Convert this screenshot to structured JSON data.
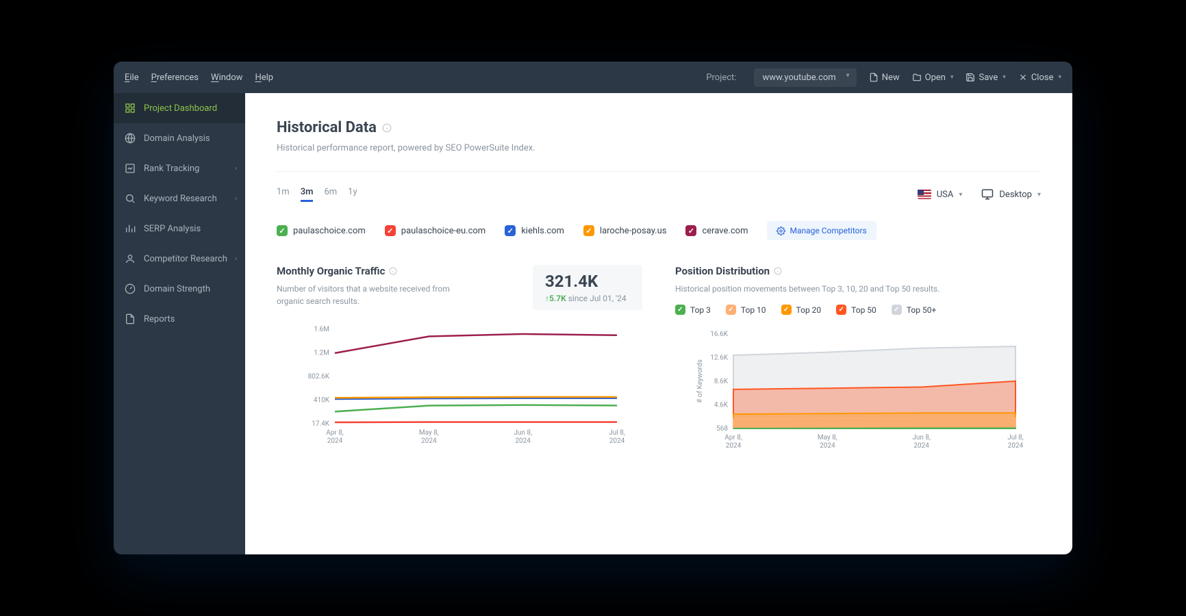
{
  "menubar": {
    "file": "File",
    "file_u": "E",
    "preferences": "Preferences",
    "preferences_u": "P",
    "window": "Window",
    "window_u": "W",
    "help": "Help",
    "help_u": "H",
    "project_label": "Project:",
    "project_value": "www.youtube.com",
    "new": "New",
    "open": "Open",
    "save": "Save",
    "close": "Close"
  },
  "sidebar": {
    "items": [
      {
        "label": "Project Dashboard",
        "icon": "dashboard",
        "active": true
      },
      {
        "label": "Domain Analysis",
        "icon": "globe"
      },
      {
        "label": "Rank Tracking",
        "icon": "chart-line",
        "chev": true
      },
      {
        "label": "Keyword Research",
        "icon": "search",
        "chev": true
      },
      {
        "label": "SERP Analysis",
        "icon": "bars"
      },
      {
        "label": "Competitor Research",
        "icon": "users",
        "chev": true
      },
      {
        "label": "Domain Strength",
        "icon": "gauge"
      },
      {
        "label": "Reports",
        "icon": "doc"
      }
    ]
  },
  "page": {
    "title": "Historical Data",
    "subtitle": "Historical performance report, powered by SEO PowerSuite Index."
  },
  "time_tabs": [
    "1m",
    "3m",
    "6m",
    "1y"
  ],
  "time_active": "3m",
  "locale": {
    "country": "USA"
  },
  "device": {
    "label": "Desktop"
  },
  "competitors": [
    {
      "label": "paulaschoice.com",
      "color": "#4caf50"
    },
    {
      "label": "paulaschoice-eu.com",
      "color": "#f44336"
    },
    {
      "label": "kiehls.com",
      "color": "#2962d9"
    },
    {
      "label": "laroche-posay.us",
      "color": "#ff9800"
    },
    {
      "label": "cerave.com",
      "color": "#9c1f4e"
    }
  ],
  "manage_label": "Manage Competitors",
  "traffic": {
    "title": "Monthly Organic Traffic",
    "subtitle": "Number of visitors that a website received from organic search results.",
    "metric": "321.4K",
    "delta": "5.7K",
    "delta_since": "since Jul 01, '24",
    "y_ticks": [
      "1.6M",
      "1.2M",
      "802.6K",
      "410K",
      "17.4K"
    ],
    "x_ticks": [
      "Apr 8, 2024",
      "May 8, 2024",
      "Jun 8, 2024",
      "Jul 8, 2024"
    ]
  },
  "position": {
    "title": "Position Distribution",
    "subtitle": "Historical position movements between Top 3, 10, 20 and Top 50 results.",
    "legend": [
      {
        "label": "Top 3",
        "color": "#4caf50"
      },
      {
        "label": "Top 10",
        "color": "#ffb074"
      },
      {
        "label": "Top 20",
        "color": "#ff9800"
      },
      {
        "label": "Top 50",
        "color": "#ff5722"
      },
      {
        "label": "Top 50+",
        "color": "#d0d5db"
      }
    ],
    "y_axis_title": "# of Keywords",
    "y_ticks": [
      "16.6K",
      "12.6K",
      "8.6K",
      "4.6K",
      "568"
    ],
    "x_ticks": [
      "Apr 8, 2024",
      "May 8, 2024",
      "Jun 8, 2024",
      "Jul 8, 2024"
    ]
  },
  "chart_data": [
    {
      "type": "line",
      "title": "Monthly Organic Traffic",
      "xlabel": "",
      "ylabel": "",
      "ylim": [
        17400,
        1600000
      ],
      "x": [
        "Apr 8, 2024",
        "May 8, 2024",
        "Jun 8, 2024",
        "Jul 8, 2024"
      ],
      "series": [
        {
          "name": "paulaschoice.com",
          "color": "#4caf50",
          "values": [
            220000,
            320000,
            330000,
            321400
          ]
        },
        {
          "name": "paulaschoice-eu.com",
          "color": "#f44336",
          "values": [
            40000,
            45000,
            45000,
            45000
          ]
        },
        {
          "name": "kiehls.com",
          "color": "#2962d9",
          "values": [
            430000,
            440000,
            445000,
            445000
          ]
        },
        {
          "name": "laroche-posay.us",
          "color": "#ff9800",
          "values": [
            450000,
            460000,
            465000,
            465000
          ]
        },
        {
          "name": "cerave.com",
          "color": "#9c1f4e",
          "values": [
            1200000,
            1480000,
            1520000,
            1500000
          ]
        }
      ]
    },
    {
      "type": "area",
      "title": "Position Distribution",
      "xlabel": "",
      "ylabel": "# of Keywords",
      "ylim": [
        568,
        16600
      ],
      "x": [
        "Apr 8, 2024",
        "May 8, 2024",
        "Jun 8, 2024",
        "Jul 8, 2024"
      ],
      "series": [
        {
          "name": "Top 3",
          "color": "#4caf50",
          "values": [
            568,
            600,
            620,
            620
          ]
        },
        {
          "name": "Top 10",
          "color": "#ffb074",
          "values": [
            2200,
            2300,
            2350,
            2350
          ]
        },
        {
          "name": "Top 20",
          "color": "#ff9800",
          "values": [
            3000,
            3100,
            3200,
            3200
          ]
        },
        {
          "name": "Top 50",
          "color": "#ff5722",
          "values": [
            7200,
            7400,
            7600,
            8600
          ]
        },
        {
          "name": "Top 50+",
          "color": "#d0d5db",
          "values": [
            13000,
            13500,
            14200,
            14500
          ]
        }
      ]
    }
  ]
}
